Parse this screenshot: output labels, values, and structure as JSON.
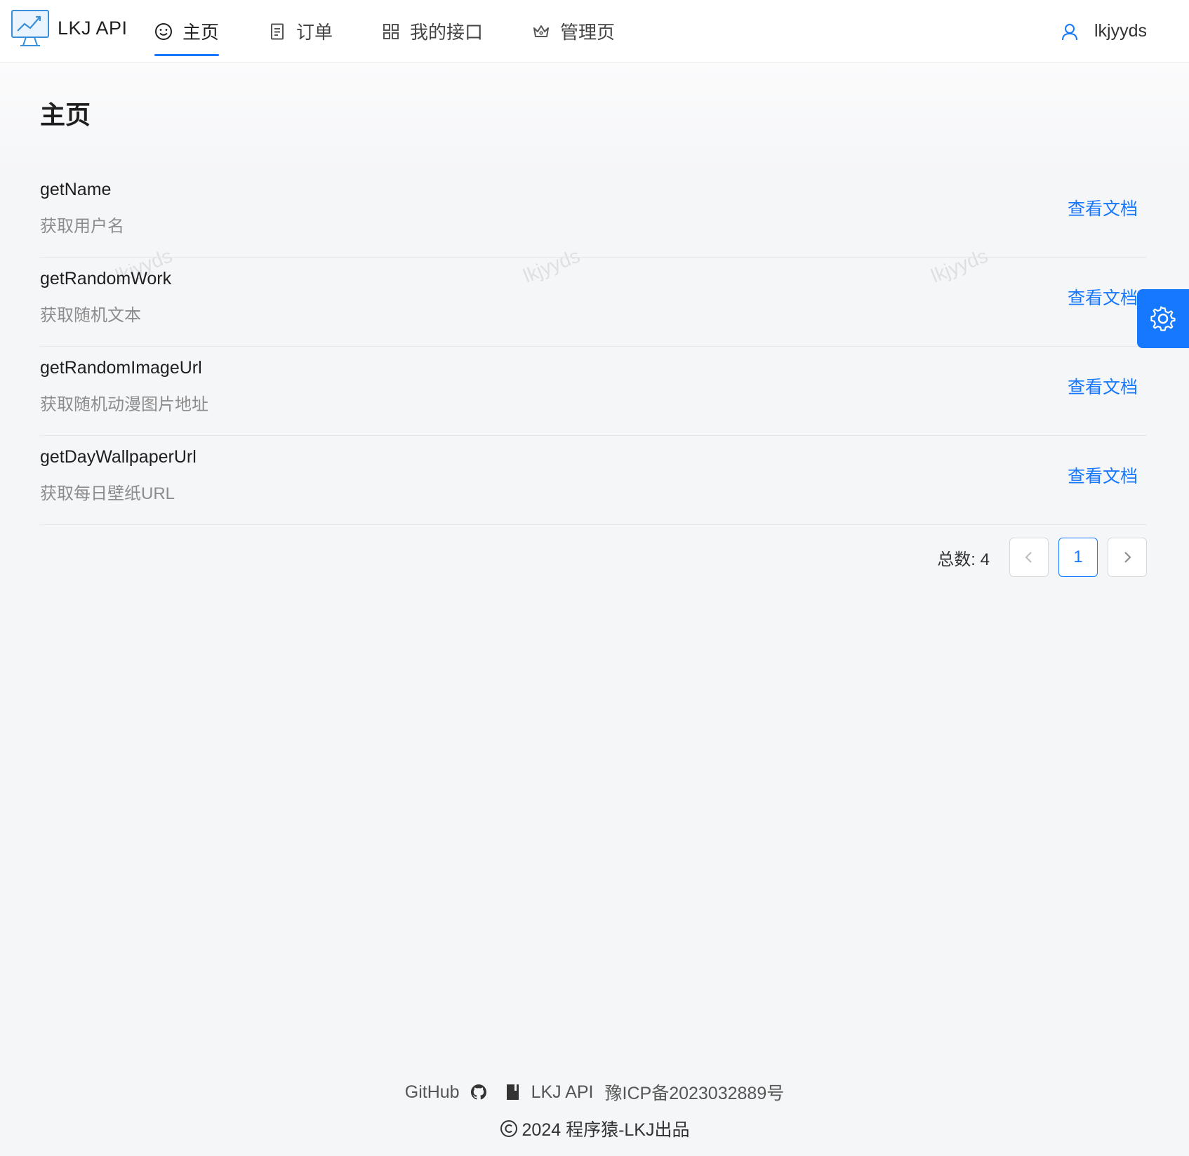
{
  "header": {
    "logo_text": "LKJ API",
    "nav": [
      {
        "label": "主页",
        "icon": "smile-icon",
        "active": true
      },
      {
        "label": "订单",
        "icon": "file-text-icon",
        "active": false
      },
      {
        "label": "我的接口",
        "icon": "appstore-icon",
        "active": false
      },
      {
        "label": "管理页",
        "icon": "crown-icon",
        "active": false
      }
    ],
    "user_name": "lkjyyds"
  },
  "main": {
    "title": "主页",
    "items": [
      {
        "name": "getName",
        "desc": "获取用户名",
        "action": "查看文档"
      },
      {
        "name": "getRandomWork",
        "desc": "获取随机文本",
        "action": "查看文档"
      },
      {
        "name": "getRandomImageUrl",
        "desc": "获取随机动漫图片地址",
        "action": "查看文档"
      },
      {
        "name": "getDayWallpaperUrl",
        "desc": "获取每日壁纸URL",
        "action": "查看文档"
      }
    ],
    "pagination": {
      "total_label": "总数:",
      "total": "4",
      "current_page": "1"
    },
    "watermark": "lkjyyds"
  },
  "footer": {
    "links": [
      "GitHub",
      "LKJ API",
      "豫ICP备2023032889号"
    ],
    "copyright": "2024 程序猿-LKJ出品"
  },
  "colors": {
    "primary": "#1677ff",
    "background": "#f5f6f8"
  }
}
